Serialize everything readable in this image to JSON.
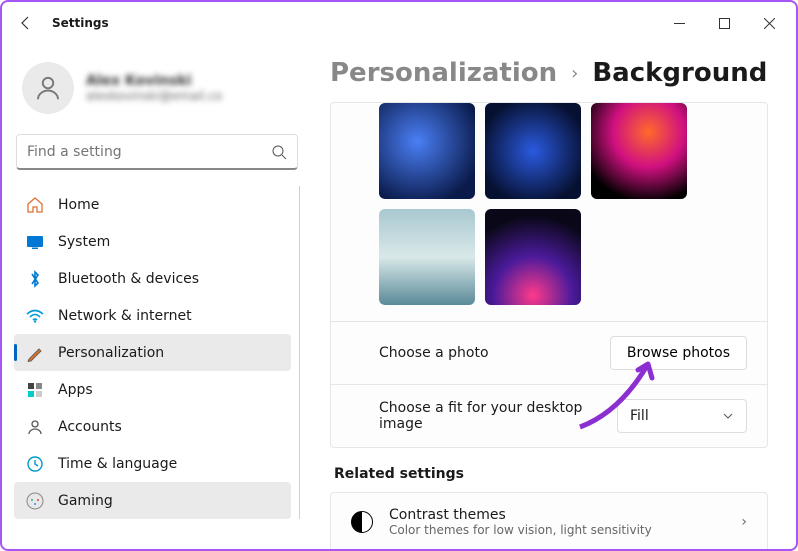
{
  "window": {
    "title": "Settings"
  },
  "user": {
    "name": "Alex Kovinski",
    "email": "alexkovinski@email.co"
  },
  "search": {
    "placeholder": "Find a setting"
  },
  "nav": [
    {
      "icon": "home",
      "label": "Home"
    },
    {
      "icon": "system",
      "label": "System"
    },
    {
      "icon": "bluetooth",
      "label": "Bluetooth & devices"
    },
    {
      "icon": "wifi",
      "label": "Network & internet"
    },
    {
      "icon": "personalization",
      "label": "Personalization",
      "active": true
    },
    {
      "icon": "apps",
      "label": "Apps"
    },
    {
      "icon": "accounts",
      "label": "Accounts"
    },
    {
      "icon": "time",
      "label": "Time & language"
    },
    {
      "icon": "gaming",
      "label": "Gaming",
      "hover": true
    }
  ],
  "breadcrumb": {
    "parent": "Personalization",
    "current": "Background"
  },
  "choose_photo": {
    "label": "Choose a photo",
    "button": "Browse photos"
  },
  "choose_fit": {
    "label": "Choose a fit for your desktop image",
    "value": "Fill"
  },
  "related": {
    "heading": "Related settings",
    "item": {
      "title": "Contrast themes",
      "subtitle": "Color themes for low vision, light sensitivity"
    }
  }
}
